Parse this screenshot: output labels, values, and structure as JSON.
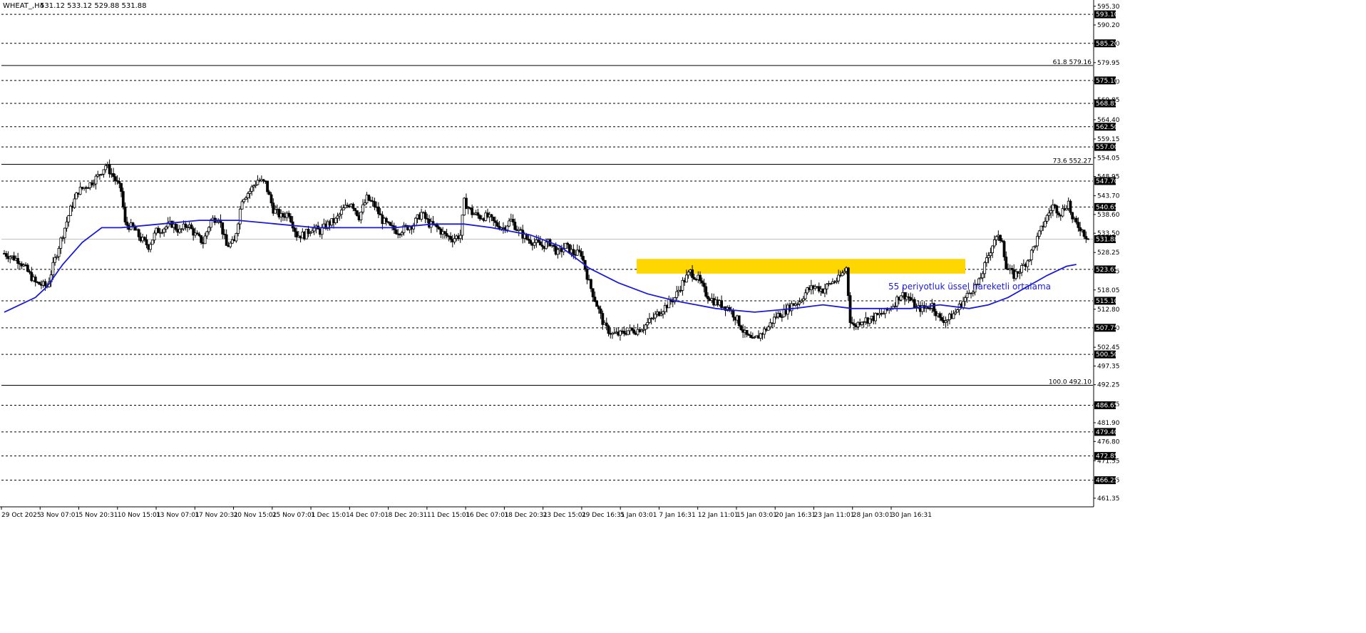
{
  "header": {
    "symbol": "WHEAT_,H4",
    "ohlc": "531.12 533.12 529.88 531.88"
  },
  "colors": {
    "background": "#ffffff",
    "candle": "#000000",
    "ema": "#1a1adc",
    "zone": "#ffd700",
    "annotation": "#1a1adc",
    "level_label_bg": "#000000"
  },
  "chart_data": {
    "type": "candlestick",
    "symbol": "WHEAT_",
    "timeframe": "H4",
    "ylim": [
      459.0,
      597.0
    ],
    "current_price": 531.88,
    "y_ticks": [
      "595.30",
      "590.20",
      "585.20",
      "579.95",
      "574.80",
      "569.85",
      "564.40",
      "559.15",
      "554.05",
      "548.95",
      "543.70",
      "538.60",
      "533.50",
      "528.25",
      "523.15",
      "518.05",
      "512.80",
      "507.70",
      "502.45",
      "497.35",
      "492.25",
      "486.95",
      "481.90",
      "476.80",
      "471.55",
      "466.25",
      "461.35"
    ],
    "x_labels": [
      "29 Oct 2025",
      "3 Nov 07:01",
      "5 Nov 20:31",
      "10 Nov 15:01",
      "13 Nov 07:01",
      "17 Nov 20:31",
      "20 Nov 15:01",
      "25 Nov 07:01",
      "1 Dec 15:01",
      "4 Dec 07:01",
      "8 Dec 20:31",
      "11 Dec 15:01",
      "16 Dec 07:01",
      "18 Dec 20:31",
      "23 Dec 15:01",
      "29 Dec 16:31",
      "5 Jan 03:01",
      "7 Jan 16:31",
      "12 Jan 11:01",
      "15 Jan 03:01",
      "20 Jan 16:31",
      "23 Jan 11:01",
      "28 Jan 03:01",
      "30 Jan 16:31"
    ],
    "horizontal_levels": [
      "593.10",
      "585.20",
      "575.10",
      "568.85",
      "562.50",
      "557.00",
      "547.70",
      "540.65",
      "523.65",
      "515.10",
      "507.75",
      "500.50",
      "486.65",
      "479.40",
      "472.85",
      "466.25"
    ],
    "fibonacci_levels": [
      {
        "label": "61.8 579.16",
        "value": 579.16
      },
      {
        "label": "73.6 552.27",
        "value": 552.27
      },
      {
        "label": "100.0 492.10",
        "value": 492.1
      }
    ],
    "support_zone": {
      "low": 522.5,
      "high": 526.5
    },
    "ema_annotation": "55 periyotluk üssel hareketli ortalama",
    "price_path": [
      [
        0,
        528
      ],
      [
        8,
        526
      ],
      [
        16,
        520
      ],
      [
        22,
        519
      ],
      [
        28,
        530
      ],
      [
        34,
        540
      ],
      [
        38,
        545
      ],
      [
        44,
        547
      ],
      [
        48,
        549
      ],
      [
        52,
        552
      ],
      [
        56,
        549
      ],
      [
        60,
        545
      ],
      [
        62,
        536
      ],
      [
        66,
        535
      ],
      [
        70,
        532
      ],
      [
        74,
        530
      ],
      [
        78,
        534
      ],
      [
        82,
        535
      ],
      [
        86,
        536
      ],
      [
        90,
        534
      ],
      [
        94,
        536
      ],
      [
        98,
        533
      ],
      [
        102,
        531
      ],
      [
        106,
        537
      ],
      [
        110,
        538
      ],
      [
        114,
        530
      ],
      [
        118,
        531
      ],
      [
        122,
        543
      ],
      [
        126,
        545
      ],
      [
        130,
        548
      ],
      [
        134,
        547
      ],
      [
        138,
        540
      ],
      [
        142,
        538
      ],
      [
        146,
        539
      ],
      [
        150,
        533
      ],
      [
        154,
        533
      ],
      [
        158,
        535
      ],
      [
        162,
        534
      ],
      [
        166,
        536
      ],
      [
        170,
        537
      ],
      [
        174,
        540
      ],
      [
        178,
        542
      ],
      [
        182,
        538
      ],
      [
        186,
        543
      ],
      [
        190,
        541
      ],
      [
        194,
        537
      ],
      [
        198,
        535
      ],
      [
        202,
        534
      ],
      [
        206,
        535
      ],
      [
        210,
        536
      ],
      [
        214,
        539
      ],
      [
        218,
        536
      ],
      [
        222,
        535
      ],
      [
        226,
        533
      ],
      [
        230,
        532
      ],
      [
        234,
        533
      ],
      [
        236,
        542
      ],
      [
        240,
        539
      ],
      [
        244,
        538
      ],
      [
        248,
        538
      ],
      [
        252,
        536
      ],
      [
        256,
        535
      ],
      [
        260,
        537
      ],
      [
        264,
        534
      ],
      [
        268,
        532
      ],
      [
        272,
        531
      ],
      [
        276,
        530
      ],
      [
        280,
        531
      ],
      [
        284,
        528
      ],
      [
        288,
        530
      ],
      [
        292,
        528
      ],
      [
        296,
        528
      ],
      [
        300,
        520
      ],
      [
        304,
        514
      ],
      [
        308,
        508
      ],
      [
        312,
        506
      ],
      [
        316,
        506
      ],
      [
        320,
        507
      ],
      [
        324,
        507
      ],
      [
        328,
        508
      ],
      [
        332,
        510
      ],
      [
        336,
        512
      ],
      [
        340,
        514
      ],
      [
        344,
        516
      ],
      [
        348,
        520
      ],
      [
        352,
        523
      ],
      [
        356,
        521
      ],
      [
        360,
        517
      ],
      [
        364,
        515
      ],
      [
        368,
        514
      ],
      [
        372,
        513
      ],
      [
        376,
        510
      ],
      [
        380,
        506
      ],
      [
        384,
        504
      ],
      [
        388,
        506
      ],
      [
        392,
        508
      ],
      [
        396,
        511
      ],
      [
        400,
        512
      ],
      [
        404,
        514
      ],
      [
        408,
        515
      ],
      [
        412,
        518
      ],
      [
        416,
        519
      ],
      [
        420,
        518
      ],
      [
        424,
        520
      ],
      [
        428,
        521
      ],
      [
        432,
        524
      ],
      [
        434,
        510
      ],
      [
        436,
        508
      ],
      [
        440,
        510
      ],
      [
        444,
        510
      ],
      [
        448,
        511
      ],
      [
        452,
        512
      ],
      [
        456,
        514
      ],
      [
        460,
        517
      ],
      [
        464,
        516
      ],
      [
        468,
        513
      ],
      [
        472,
        513
      ],
      [
        476,
        514
      ],
      [
        480,
        510
      ],
      [
        484,
        510
      ],
      [
        488,
        512
      ],
      [
        492,
        515
      ],
      [
        496,
        518
      ],
      [
        500,
        520
      ],
      [
        504,
        526
      ],
      [
        508,
        532
      ],
      [
        512,
        532
      ],
      [
        514,
        524
      ],
      [
        518,
        522
      ],
      [
        522,
        524
      ],
      [
        526,
        527
      ],
      [
        530,
        532
      ],
      [
        534,
        537
      ],
      [
        538,
        541
      ],
      [
        542,
        539
      ],
      [
        546,
        542
      ],
      [
        548,
        537
      ],
      [
        552,
        535
      ],
      [
        556,
        531.88
      ]
    ],
    "ema_path": [
      [
        0,
        512
      ],
      [
        16,
        516
      ],
      [
        22,
        519
      ],
      [
        30,
        525
      ],
      [
        40,
        531
      ],
      [
        50,
        535
      ],
      [
        60,
        535
      ],
      [
        80,
        536
      ],
      [
        100,
        537
      ],
      [
        110,
        537
      ],
      [
        120,
        537
      ],
      [
        140,
        536
      ],
      [
        160,
        535
      ],
      [
        180,
        535
      ],
      [
        200,
        535
      ],
      [
        220,
        536
      ],
      [
        236,
        536
      ],
      [
        250,
        535
      ],
      [
        270,
        533
      ],
      [
        285,
        530
      ],
      [
        300,
        524
      ],
      [
        315,
        520
      ],
      [
        330,
        517
      ],
      [
        345,
        515
      ],
      [
        355,
        514
      ],
      [
        365,
        513
      ],
      [
        375,
        512.5
      ],
      [
        385,
        512
      ],
      [
        395,
        512.5
      ],
      [
        405,
        513
      ],
      [
        420,
        514
      ],
      [
        435,
        513
      ],
      [
        450,
        513
      ],
      [
        465,
        513
      ],
      [
        480,
        514
      ],
      [
        495,
        513
      ],
      [
        505,
        514
      ],
      [
        515,
        516
      ],
      [
        525,
        519
      ],
      [
        535,
        522
      ],
      [
        545,
        524.5
      ],
      [
        550,
        525
      ]
    ]
  }
}
